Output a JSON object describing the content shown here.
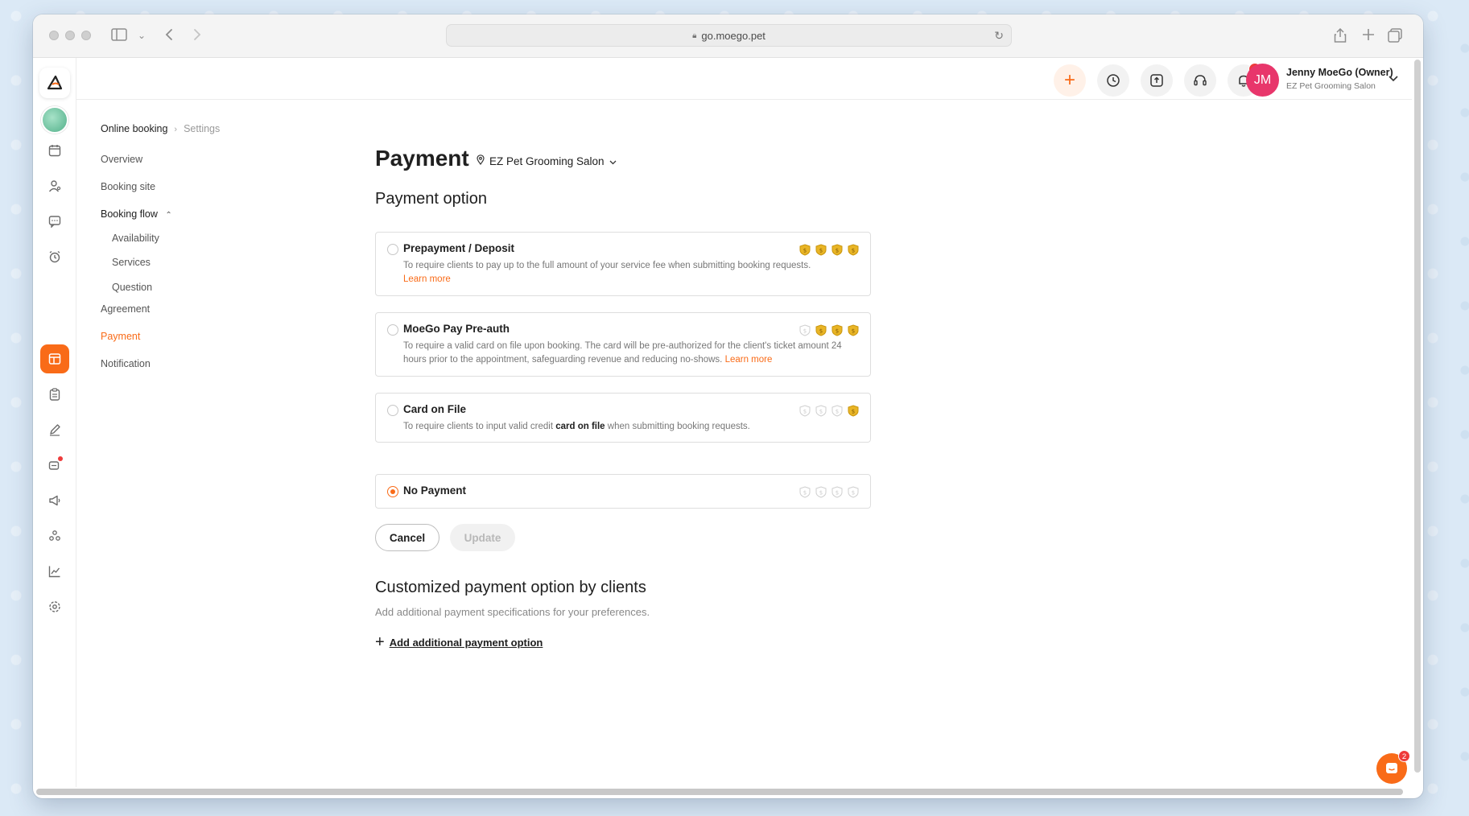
{
  "browser": {
    "url": "go.moego.pet"
  },
  "header": {
    "notifications_count": "2",
    "user": {
      "initials": "JM",
      "name": "Jenny MoeGo (Owner)",
      "business": "EZ Pet Grooming Salon"
    }
  },
  "breadcrumb": {
    "root": "Online booking",
    "current": "Settings"
  },
  "subnav": {
    "items": [
      {
        "label": "Overview"
      },
      {
        "label": "Booking site"
      },
      {
        "label": "Booking flow"
      },
      {
        "label": "Availability"
      },
      {
        "label": "Services"
      },
      {
        "label": "Question"
      },
      {
        "label": "Agreement"
      },
      {
        "label": "Payment"
      },
      {
        "label": "Notification"
      }
    ],
    "active": "Payment"
  },
  "page": {
    "title": "Payment",
    "location": "EZ Pet Grooming Salon"
  },
  "payment_option": {
    "heading": "Payment option",
    "options": [
      {
        "title": "Prepayment / Deposit",
        "desc": "To require clients to pay up to the full amount of your service fee when submitting booking requests.",
        "link": "Learn more",
        "tiers": [
          true,
          true,
          true,
          true
        ],
        "selected": false
      },
      {
        "title": "MoeGo Pay Pre-auth",
        "desc": "To require a valid card on file upon booking. The card will be pre-authorized for the client's ticket amount 24 hours prior to the appointment, safeguarding revenue and reducing no-shows.",
        "link": "Learn more",
        "tiers": [
          false,
          true,
          true,
          true
        ],
        "selected": false
      },
      {
        "title": "Card on File",
        "desc_pre": "To require clients to input valid credit",
        "desc_bold": "card on file",
        "desc_post": "when submitting booking requests.",
        "tiers": [
          false,
          false,
          false,
          true
        ],
        "selected": false
      },
      {
        "title": "No Payment",
        "tiers": [
          false,
          false,
          false,
          false
        ],
        "selected": true
      }
    ],
    "cancel_label": "Cancel",
    "update_label": "Update"
  },
  "custom_option": {
    "heading": "Customized payment option by clients",
    "subtitle": "Add additional payment specifications for your preferences.",
    "add_label": "Add additional payment option"
  },
  "chat": {
    "badge": "2"
  },
  "colors": {
    "accent": "#f96b18",
    "badge": "#ee3b3b",
    "avatar": "#e8366b",
    "tier_active": "#e9b526",
    "tier_inactive": "#cfcfcf"
  }
}
